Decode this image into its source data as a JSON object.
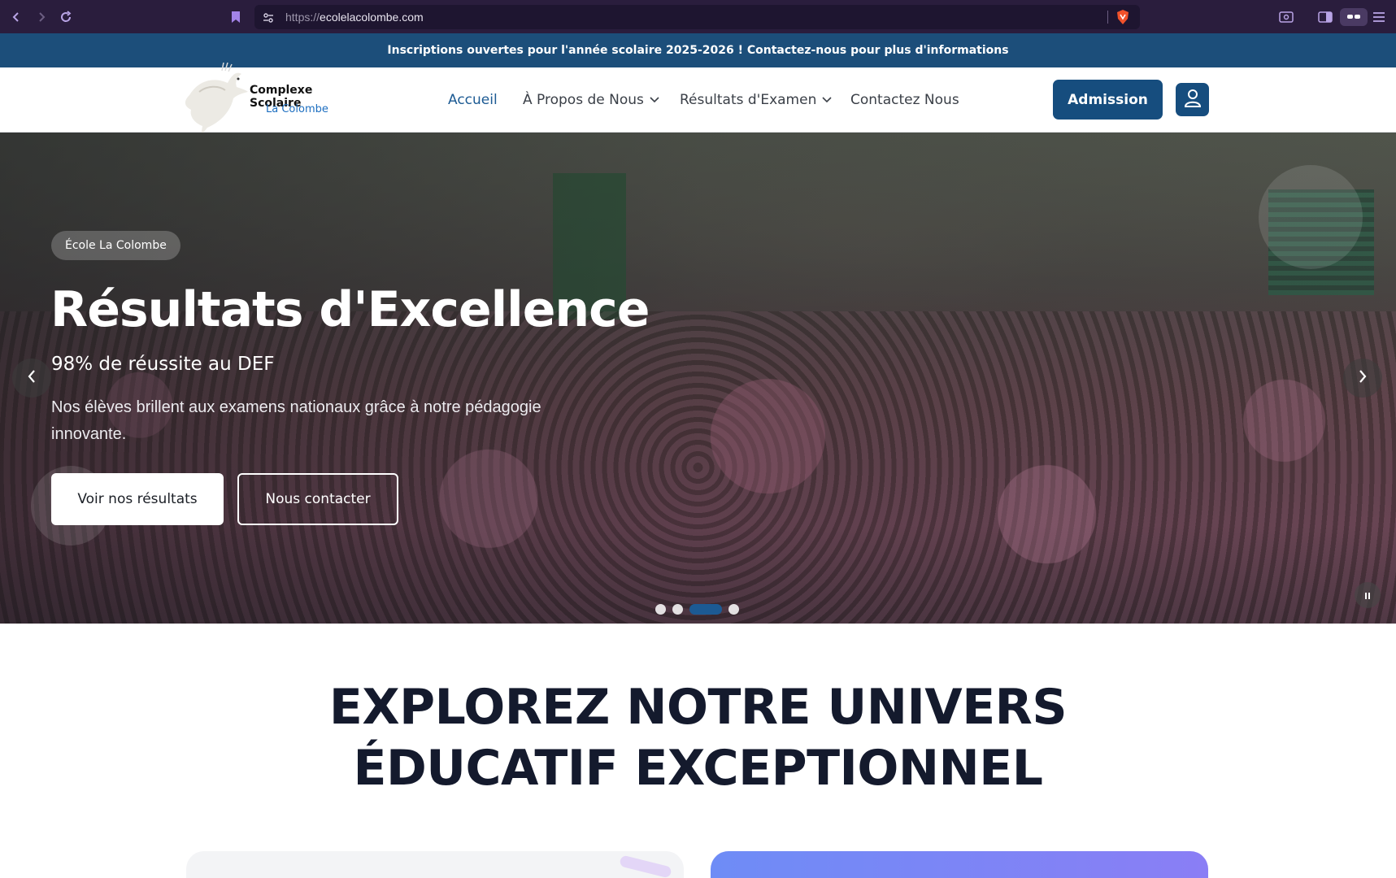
{
  "browser": {
    "url_protocol": "https://",
    "url_host": "ecolelacolombe.com",
    "icons": [
      "back-icon",
      "forward-icon",
      "reload-icon",
      "bookmark-icon",
      "site-settings-icon",
      "brave-shield-icon",
      "screenshot-icon",
      "sidebar-icon",
      "vpn-icon",
      "menu-icon"
    ]
  },
  "announcement": {
    "text": "Inscriptions ouvertes pour l'année scolaire 2025-2026 ! Contactez-nous pour plus d'informations",
    "color": "#1c4e7a"
  },
  "header": {
    "logo_line1": "Complexe Scolaire",
    "logo_line2": "La Colombe",
    "nav": [
      {
        "label": "Accueil",
        "active": true
      },
      {
        "label": "À Propos de Nous",
        "dropdown": true
      },
      {
        "label": "Résultats d'Examen",
        "dropdown": true
      },
      {
        "label": "Contactez Nous"
      }
    ],
    "admission_label": "Admission",
    "accent_color": "#164d7e"
  },
  "hero": {
    "badge": "École La Colombe",
    "title": "Résultats d'Excellence",
    "subtitle": "98% de réussite au DEF",
    "description": "Nos élèves brillent aux examens nationaux grâce à notre pédagogie innovante.",
    "primary_button": "Voir nos résultats",
    "secondary_button": "Nous contacter",
    "slides_total": 4,
    "active_slide": 3
  },
  "section": {
    "title_line1": "EXPLOREZ NOTRE UNIVERS",
    "title_line2": "ÉDUCATIF EXCEPTIONNEL"
  }
}
